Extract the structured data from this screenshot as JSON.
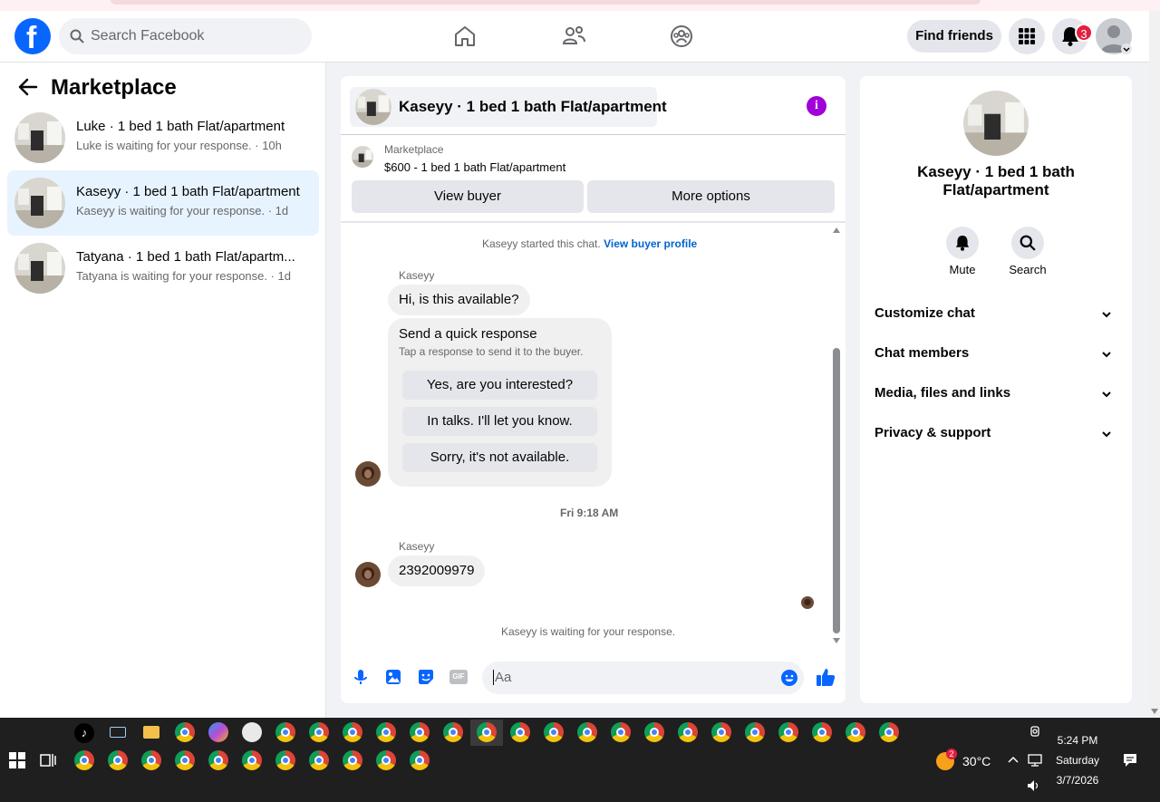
{
  "header": {
    "search_placeholder": "Search Facebook",
    "find_friends": "Find friends",
    "notifications_count": "3"
  },
  "sidebar": {
    "title": "Marketplace",
    "conversations": [
      {
        "title": "Luke · 1 bed 1 bath Flat/apartment",
        "subtitle": "Luke is waiting for your response. · 10h",
        "active": false
      },
      {
        "title": "Kaseyy · 1 bed 1 bath Flat/apartment",
        "subtitle": "Kaseyy is waiting for your response. · 1d",
        "active": true
      },
      {
        "title": "Tatyana · 1 bed 1 bath Flat/apartm...",
        "subtitle": "Tatyana is waiting for your response. · 1d",
        "active": false
      }
    ]
  },
  "chat": {
    "title": "Kaseyy · 1 bed 1 bath Flat/apartment",
    "listing_label": "Marketplace",
    "listing_price": "$600 - 1 bed 1 bath Flat/apartment",
    "view_buyer": "View buyer",
    "more_options": "More options",
    "started_text": "Kaseyy started this chat.",
    "view_profile_link": "View buyer profile",
    "sender_name": "Kaseyy",
    "msg1": "Hi, is this available?",
    "quick_title": "Send a quick response",
    "quick_sub": "Tap a response to send it to the buyer.",
    "quick_responses": [
      "Yes, are you interested?",
      "In talks. I'll let you know.",
      "Sorry, it's not available."
    ],
    "timestamp": "Fri 9:18 AM",
    "msg2": "2392009979",
    "waiting_text": "Kaseyy is waiting for your response.",
    "composer_placeholder": "Aa",
    "gif_label": "GIF"
  },
  "info_panel": {
    "title": "Kaseyy · 1 bed 1 bath Flat/apartment",
    "mute": "Mute",
    "search": "Search",
    "sections": [
      "Customize chat",
      "Chat members",
      "Media, files and links",
      "Privacy & support"
    ]
  },
  "taskbar": {
    "temperature": "30°C",
    "weather_badge": "2",
    "time": "5:24 PM",
    "day": "Saturday",
    "date": "3/7/2026"
  },
  "colors": {
    "brand": "#0866ff",
    "active_bg": "#e7f3ff",
    "link": "#0064d1",
    "badge": "#e41e3f",
    "info": "#a100d9"
  }
}
